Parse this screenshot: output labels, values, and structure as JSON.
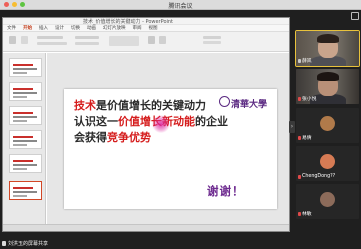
{
  "window": {
    "title": "腾讯会议"
  },
  "ppt": {
    "doc_title": "技术_价值增长的关键动力 - PowerPoint",
    "tabs": [
      "文件",
      "开始",
      "插入",
      "设计",
      "切换",
      "动画",
      "幻灯片放映",
      "审阅",
      "视图"
    ],
    "active_tab": "开始"
  },
  "slide": {
    "logo_text": "清華大學",
    "line1": {
      "red": "技术",
      "dark": "是价值增长的关键动力"
    },
    "line2": {
      "dark_a": "认识这一",
      "red": "价值增长新动能",
      "dark_b": "的企业"
    },
    "line3": {
      "dark": "会获得",
      "red": "竞争优势"
    },
    "thanks": "谢谢！"
  },
  "participants": [
    {
      "name": "薛岚",
      "muted": false,
      "type": "video",
      "active": true
    },
    {
      "name": "张小悦",
      "muted": true,
      "type": "video",
      "active": false
    },
    {
      "name": "易倩",
      "muted": true,
      "type": "avatar",
      "color": "#b07a4a",
      "active": false
    },
    {
      "name": "ChengDong??",
      "muted": true,
      "type": "avatar",
      "color": "#d67b54",
      "active": false
    },
    {
      "name": "林敏",
      "muted": true,
      "type": "avatar",
      "color": "#8c6b5a",
      "active": false
    }
  ],
  "speaker": {
    "label": "刘洪玉的屏幕共享"
  },
  "colors": {
    "accent_red": "#d51c1c",
    "thanks_purple": "#6d2a8f",
    "active_outline": "#e8c23c"
  }
}
